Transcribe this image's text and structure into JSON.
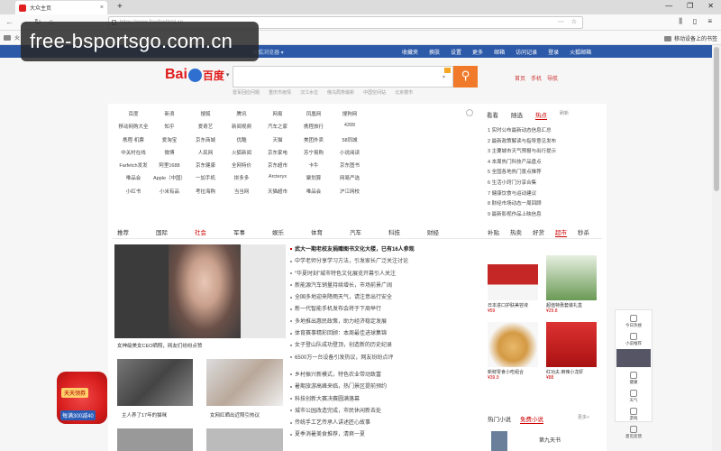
{
  "browser": {
    "tab_title": "大众主页",
    "tab_close": "×",
    "new_tab": "+",
    "url": "https://www.freefoxhtml.cn",
    "window_buttons": [
      "—",
      "❐",
      "✕"
    ],
    "bookmark_left": "火",
    "bookmark_right": "移动设备上的书签"
  },
  "watermark": "free-bsportsgo.com.cn",
  "topnav": {
    "left": "火狐浏览器 ▾",
    "items": [
      "收藏夹",
      "换肤",
      "设置",
      "更多",
      "邮箱",
      "访问记录",
      "登录",
      "火狐邮箱"
    ]
  },
  "search": {
    "logo_bai": "Bai",
    "logo_du": "百度",
    "caret": "▾",
    "button_icon": "⚲",
    "hot_words": [
      "雷军回应问题",
      "重庆市疫情",
      "汉江水位",
      "俄乌局势最新",
      "中国空间站",
      "北京楼市"
    ],
    "top_links": [
      "首页",
      "手机",
      "导航"
    ]
  },
  "sites": [
    [
      "百度",
      "新浪",
      "搜狐",
      "腾讯",
      "网易",
      "凤凰网",
      "搜狗网"
    ],
    [
      "移动网购大全",
      "知乎",
      "爱奇艺",
      "新闻视频",
      "汽车之家",
      "携程旅行",
      "4399"
    ],
    [
      "携程·机票",
      "爱淘宝",
      "京东商城",
      "优酷",
      "天猫",
      "美团外卖",
      "58同城"
    ],
    [
      "中关村在线",
      "微博",
      "人民网",
      "火狐新闻",
      "京东家电",
      "苏宁易购",
      "小说阅读"
    ],
    [
      "Farfetch发发",
      "阿里1688",
      "京东健康",
      "全网特价",
      "京东超市",
      "卡牛",
      "京东图书"
    ],
    [
      "唯品会",
      "Apple（中国）",
      "一加手机",
      "拼多多",
      "Arcteryx",
      "聚划算",
      "网易严选"
    ],
    [
      "小红书",
      "小米有品",
      "考拉海购",
      "当当网",
      "天猫超市",
      "唯品会",
      "沪江网校"
    ]
  ],
  "right_tabs": [
    "看看",
    "随选",
    "热点",
    "刷新"
  ],
  "right_news": [
    "1 实时公布最新动态信息汇总",
    "2 最新政策解读与指导意见发布",
    "3 主要城市天气预报与出行提示",
    "4 本周热门科技产品盘点",
    "5 全国各地热门景点推荐",
    "6 生活小窍门分享合集",
    "7 健康饮食与运动建议",
    "8 财经市场动态一周回顾",
    "9 最新影视作品上映信息"
  ],
  "categories": [
    "推荐",
    "国际",
    "社会",
    "军事",
    "娱乐",
    "体育",
    "汽车",
    "科技",
    "财经"
  ],
  "right_categories": [
    "补贴",
    "热卖",
    "好货",
    "超市",
    "秒杀"
  ],
  "big_caption": "女神级美女CEO晒照，网友们纷纷点赞",
  "headlines": [
    "武大一期老校友捐赠图书文化大楼，已有16人参观",
    "中学老师分享学习方法，引发家长广泛关注讨论",
    "“华夏时刻”城市特色文化展览开幕引人关注",
    "新能源汽车销量持续增长，市场前景广阔",
    "全国多地迎来降雨天气，请注意出行安全",
    "新一代智能手机发布会将于下周举行",
    "多地推出惠民政策，助力经济稳定发展",
    "体育赛事精彩回顾：本周最佳进球集锦",
    "女子登山队成功登顶，创造新的历史纪录",
    "6500万一台设备引发热议，网友纷纷点评"
  ],
  "headlines2": [
    "乡村振兴新模式，特色农业带动致富",
    "暑期旅游高峰来临，热门景区提前预约",
    "科技创新大赛决赛圆满落幕",
    "城市公园改造完成，市民休闲新去处",
    "传统手工艺传承人讲述匠心故事",
    "夏季消暑美食推荐，清爽一夏"
  ],
  "thumb_caption_1": "主人养了17年的猫咪",
  "thumb_caption_2": "女网红晒出近照引热议",
  "products": [
    {
      "name": "日本进口护肤美容液",
      "price": "¥59"
    },
    {
      "name": "超值特惠套装礼盒",
      "price": "¥29.8"
    },
    {
      "name": "新鲜零食小吃组合",
      "price": "¥39.9"
    },
    {
      "name": "红功夫 麻辣小龙虾",
      "price": "¥88"
    }
  ],
  "right_bottom": {
    "tabs": [
      "热门小说",
      "免费小说"
    ],
    "more": "更多>",
    "book_title": "第九天书"
  },
  "sidebar": [
    "今日热搜",
    "小说推荐",
    "健康",
    "天气",
    "游戏",
    "意见反馈"
  ],
  "promo": {
    "top": "天天领券",
    "bottom": "每满300减40"
  }
}
